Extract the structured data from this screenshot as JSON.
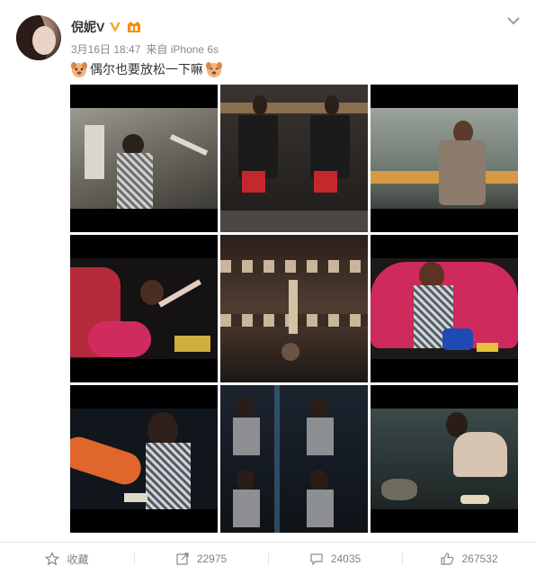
{
  "author": {
    "name": "倪妮V",
    "verified_icon": "verified-v-icon",
    "vip_icon": "vip-badge-icon"
  },
  "post": {
    "date": "3月16日 18:47",
    "source": "来自 iPhone 6s",
    "text": "偶尔也要放松一下嘛",
    "emoji_left": "dog-emoji-icon",
    "emoji_right": "dog-emoji-icon",
    "photo_count": 9
  },
  "actions": {
    "favorite_label": "收藏",
    "repost_count": "22975",
    "comment_count": "24035",
    "like_count": "267532"
  },
  "colors": {
    "verified": "#f5a623",
    "vip": "#ff8a00",
    "text": "#333333",
    "meta": "#888888",
    "action": "#808080"
  }
}
